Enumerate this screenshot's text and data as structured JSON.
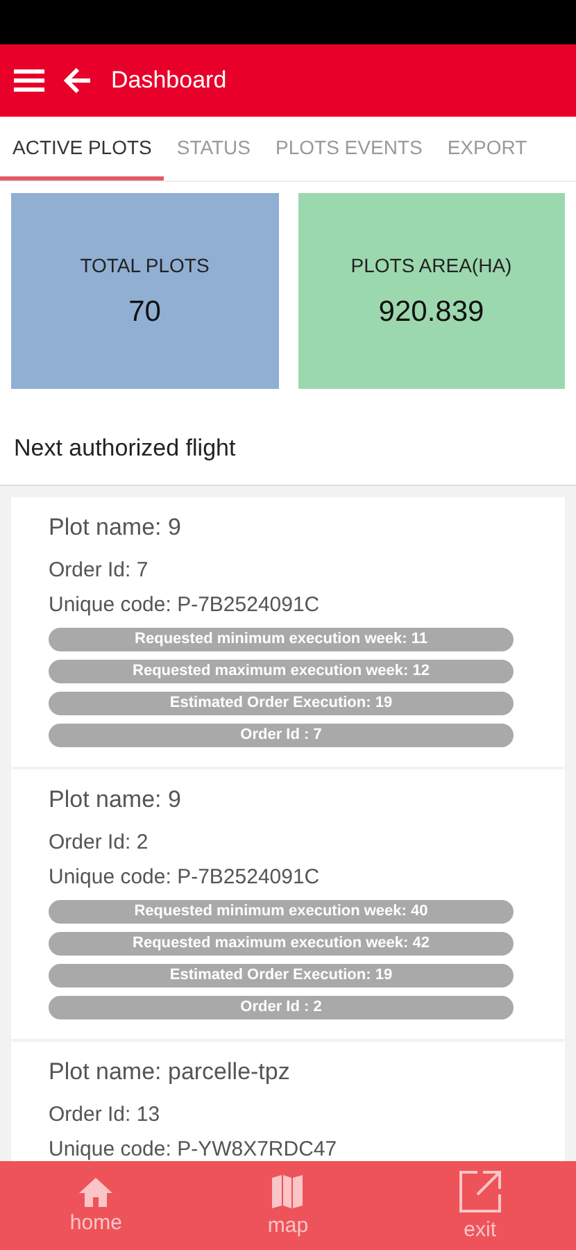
{
  "app_bar": {
    "title": "Dashboard"
  },
  "tabs": [
    {
      "label": "ACTIVE PLOTS",
      "selected": true
    },
    {
      "label": "STATUS",
      "selected": false
    },
    {
      "label": "PLOTS EVENTS",
      "selected": false
    },
    {
      "label": "EXPORT",
      "selected": false
    }
  ],
  "tiles": [
    {
      "label": "TOTAL PLOTS",
      "value": "70",
      "color": "#90afd3"
    },
    {
      "label": "PLOTS AREA(HA)",
      "value": "920.839",
      "color": "#9cd8ae"
    }
  ],
  "section_title": "Next authorized flight",
  "plots": [
    {
      "name": "Plot name: 9",
      "order": "Order Id: 7",
      "code": "Unique code: P-7B2524091C",
      "tags": [
        "Requested minimum execution week: 11",
        "Requested maximum execution week: 12",
        "Estimated Order Execution: 19",
        "Order Id : 7"
      ]
    },
    {
      "name": "Plot name: 9",
      "order": "Order Id: 2",
      "code": "Unique code: P-7B2524091C",
      "tags": [
        "Requested minimum execution week: 40",
        "Requested maximum execution week: 42",
        "Estimated Order Execution: 19",
        "Order Id : 2"
      ]
    },
    {
      "name": "Plot name: parcelle-tpz",
      "order": "Order Id: 13",
      "code": "Unique code: P-YW8X7RDC47"
    }
  ],
  "bottom_nav": [
    {
      "label": "home",
      "kind": "home"
    },
    {
      "label": "map",
      "kind": "map"
    },
    {
      "label": "exit",
      "kind": "exit"
    }
  ]
}
